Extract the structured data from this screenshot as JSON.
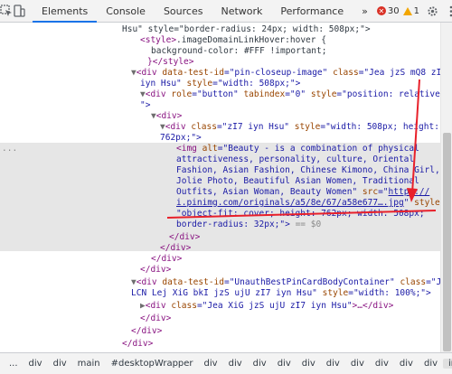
{
  "toolbar": {
    "tabs": [
      "Elements",
      "Console",
      "Sources",
      "Network",
      "Performance"
    ],
    "more": "»",
    "error_count": "30",
    "warning_count": "1"
  },
  "tree": {
    "l0a": "Hsu\" style=\"border-radius: 24px; width: 508px;\">",
    "l1a": "<style>",
    "l1b": ".imageDomainLinkHover:hover {",
    "l2": "background-color: #FFF !important;",
    "l3a": "}</style>",
    "l4a": "<div",
    "l4b": " data-test-id",
    "l4c": "=\"pin-closeup-image\"",
    "l4d": " class",
    "l4e": "=\"Jea jzS mQ8 zI7",
    "l5a": "iyn Hsu\"",
    "l5b": " style",
    "l5c": "=\"width: 508px;\">",
    "l6a": "<div",
    "l6b": " role",
    "l6c": "=\"button\"",
    "l6d": " tabindex",
    "l6e": "=\"0\"",
    "l6f": " style",
    "l6g": "=\"position: relative;",
    "l7": "\">",
    "l8": "<div>",
    "l9a": "<div",
    "l9b": " class",
    "l9c": "=\"zI7 iyn Hsu\"",
    "l9d": " style",
    "l9e": "=\"width: 508px; height:",
    "l10": "762px;\">",
    "img1a": "<img",
    "img1b": " alt",
    "img1c": "=\"Beauty - is a combination of physical",
    "img2": "attractiveness, personality, culture, Oriental",
    "img3": "Fashion, Asian Fashion, Chinese Kimono, China Girl,",
    "img4": "Jolie Photo, Beautiful Asian Women, Traditional",
    "img5a": "Outfits, Asian Woman, Beauty Women\"",
    "img5b": " src",
    "img5c": "=\"",
    "img5d": "https://",
    "img6a": "i.pinimg.com/originals/a5/8e/67/a58e677….jpg",
    "img6b": "\"",
    "img6c": " style",
    "img6d": "=",
    "img7": "\"object-fit: cover; height: 762px; width: 508px;",
    "img8a": "border-radius: 32px;\">",
    "img8b": " == $0",
    "c1": "</div>",
    "c2": "</div>",
    "c3": "</div>",
    "c4": "</div>",
    "u1a": "<div",
    "u1b": " data-test-id",
    "u1c": "=\"UnauthBestPinCardBodyContainer\"",
    "u1d": " class",
    "u1e": "=\"Jea",
    "u2a": "LCN Lej XiG bkI jzS ujU zI7 iyn Hsu\"",
    "u2b": " style",
    "u2c": "=\"width: 100%;\">",
    "u3a": "<div",
    "u3b": " class",
    "u3c": "=\"Jea XiG jzS ujU zI7 iyn Hsu\"",
    "u3d": ">…</div>",
    "u4": "</div>",
    "u5": "</div>",
    "u6": "</div>",
    "dots": "..."
  },
  "breadcrumbs": [
    "...",
    "div",
    "div",
    "main",
    "#desktopWrapper",
    "div",
    "div",
    "div",
    "div",
    "div",
    "div",
    "div",
    "div",
    "div",
    "div",
    "img"
  ],
  "annotation_color": "#e8202a"
}
